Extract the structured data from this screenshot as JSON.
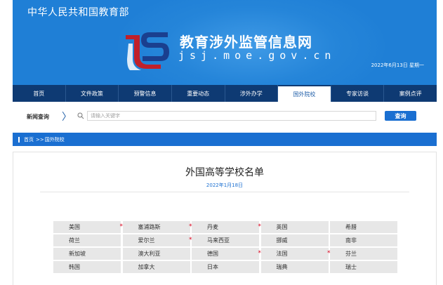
{
  "header": {
    "ministry": "中华人民共和国教育部",
    "site_title": "教育涉外监管信息网",
    "site_url": "jsj.moe.gov.cn",
    "date": "2022年6月13日 星期一"
  },
  "nav": {
    "items": [
      {
        "label": "首页"
      },
      {
        "label": "文件政策"
      },
      {
        "label": "预警信息"
      },
      {
        "label": "重要动态"
      },
      {
        "label": "涉外办学"
      },
      {
        "label": "国外院校"
      },
      {
        "label": "专家访谈"
      },
      {
        "label": "案例点评"
      }
    ],
    "active": "国外院校"
  },
  "search": {
    "label": "新闻查询",
    "placeholder": "请输入关键字",
    "button": "查询"
  },
  "breadcrumb": {
    "home": "首页",
    "separator": ">>",
    "current": "国外院校"
  },
  "article": {
    "title": "外国高等学校名单",
    "date": "2022年1月18日"
  },
  "countries": [
    {
      "name": "美国",
      "star": false
    },
    {
      "name": "塞浦路斯",
      "star": true
    },
    {
      "name": "丹麦",
      "star": true
    },
    {
      "name": "英国",
      "star": true
    },
    {
      "name": "希腊",
      "star": false
    },
    {
      "name": "荷兰",
      "star": false
    },
    {
      "name": "爱尔兰",
      "star": false
    },
    {
      "name": "马来西亚",
      "star": true
    },
    {
      "name": "挪威",
      "star": false
    },
    {
      "name": "南非",
      "star": false
    },
    {
      "name": "新加坡",
      "star": false
    },
    {
      "name": "澳大利亚",
      "star": false
    },
    {
      "name": "德国",
      "star": false
    },
    {
      "name": "法国",
      "star": true
    },
    {
      "name": "芬兰",
      "star": true
    },
    {
      "name": "韩国",
      "star": false
    },
    {
      "name": "加拿大",
      "star": false
    },
    {
      "name": "日本",
      "star": false
    },
    {
      "name": "瑞典",
      "star": false
    },
    {
      "name": "瑞士",
      "star": false
    }
  ],
  "star_symbol": "*",
  "colors": {
    "banner": "#1f7fd6",
    "nav": "#0e3a73",
    "accent": "#1a6fd1",
    "star": "#d9001b"
  }
}
